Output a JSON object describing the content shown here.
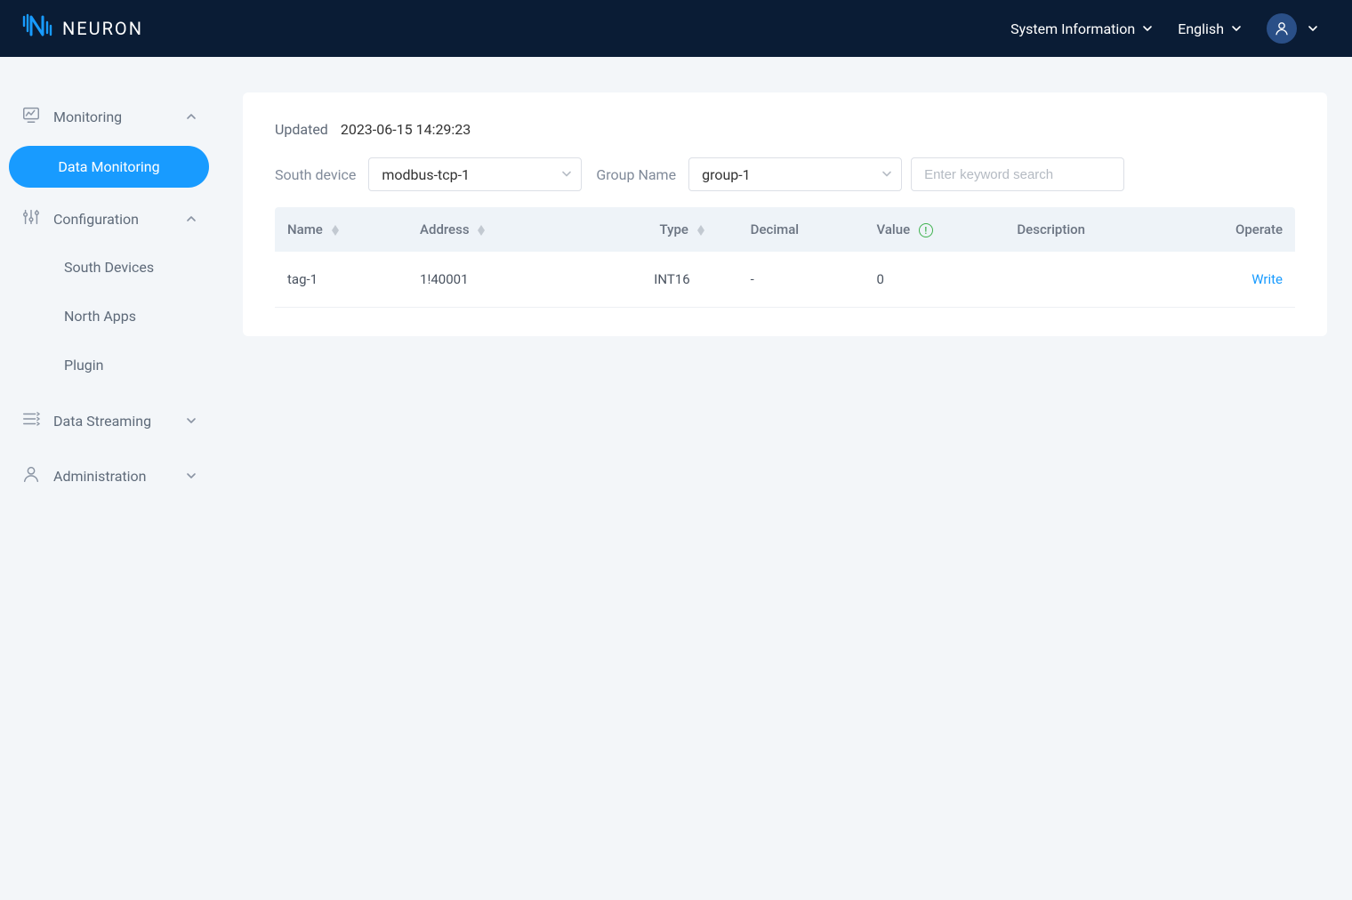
{
  "brand": "NEURON",
  "topbar": {
    "system_info": "System Information",
    "language": "English"
  },
  "sidebar": {
    "monitoring": {
      "label": "Monitoring",
      "expanded": true,
      "items": {
        "data_monitoring": "Data Monitoring"
      }
    },
    "configuration": {
      "label": "Configuration",
      "expanded": true,
      "items": {
        "south_devices": "South Devices",
        "north_apps": "North Apps",
        "plugin": "Plugin"
      }
    },
    "data_streaming": {
      "label": "Data Streaming",
      "expanded": false
    },
    "administration": {
      "label": "Administration",
      "expanded": false
    }
  },
  "panel": {
    "updated_label": "Updated",
    "updated_value": "2023-06-15 14:29:23",
    "south_device_label": "South device",
    "south_device_value": "modbus-tcp-1",
    "group_name_label": "Group Name",
    "group_name_value": "group-1",
    "search_placeholder": "Enter keyword search"
  },
  "table": {
    "columns": {
      "name": "Name",
      "address": "Address",
      "type": "Type",
      "decimal": "Decimal",
      "value": "Value",
      "description": "Description",
      "operate": "Operate"
    },
    "rows": [
      {
        "name": "tag-1",
        "address": "1!40001",
        "type": "INT16",
        "decimal": "-",
        "value": "0",
        "description": "",
        "operate": "Write"
      }
    ]
  }
}
